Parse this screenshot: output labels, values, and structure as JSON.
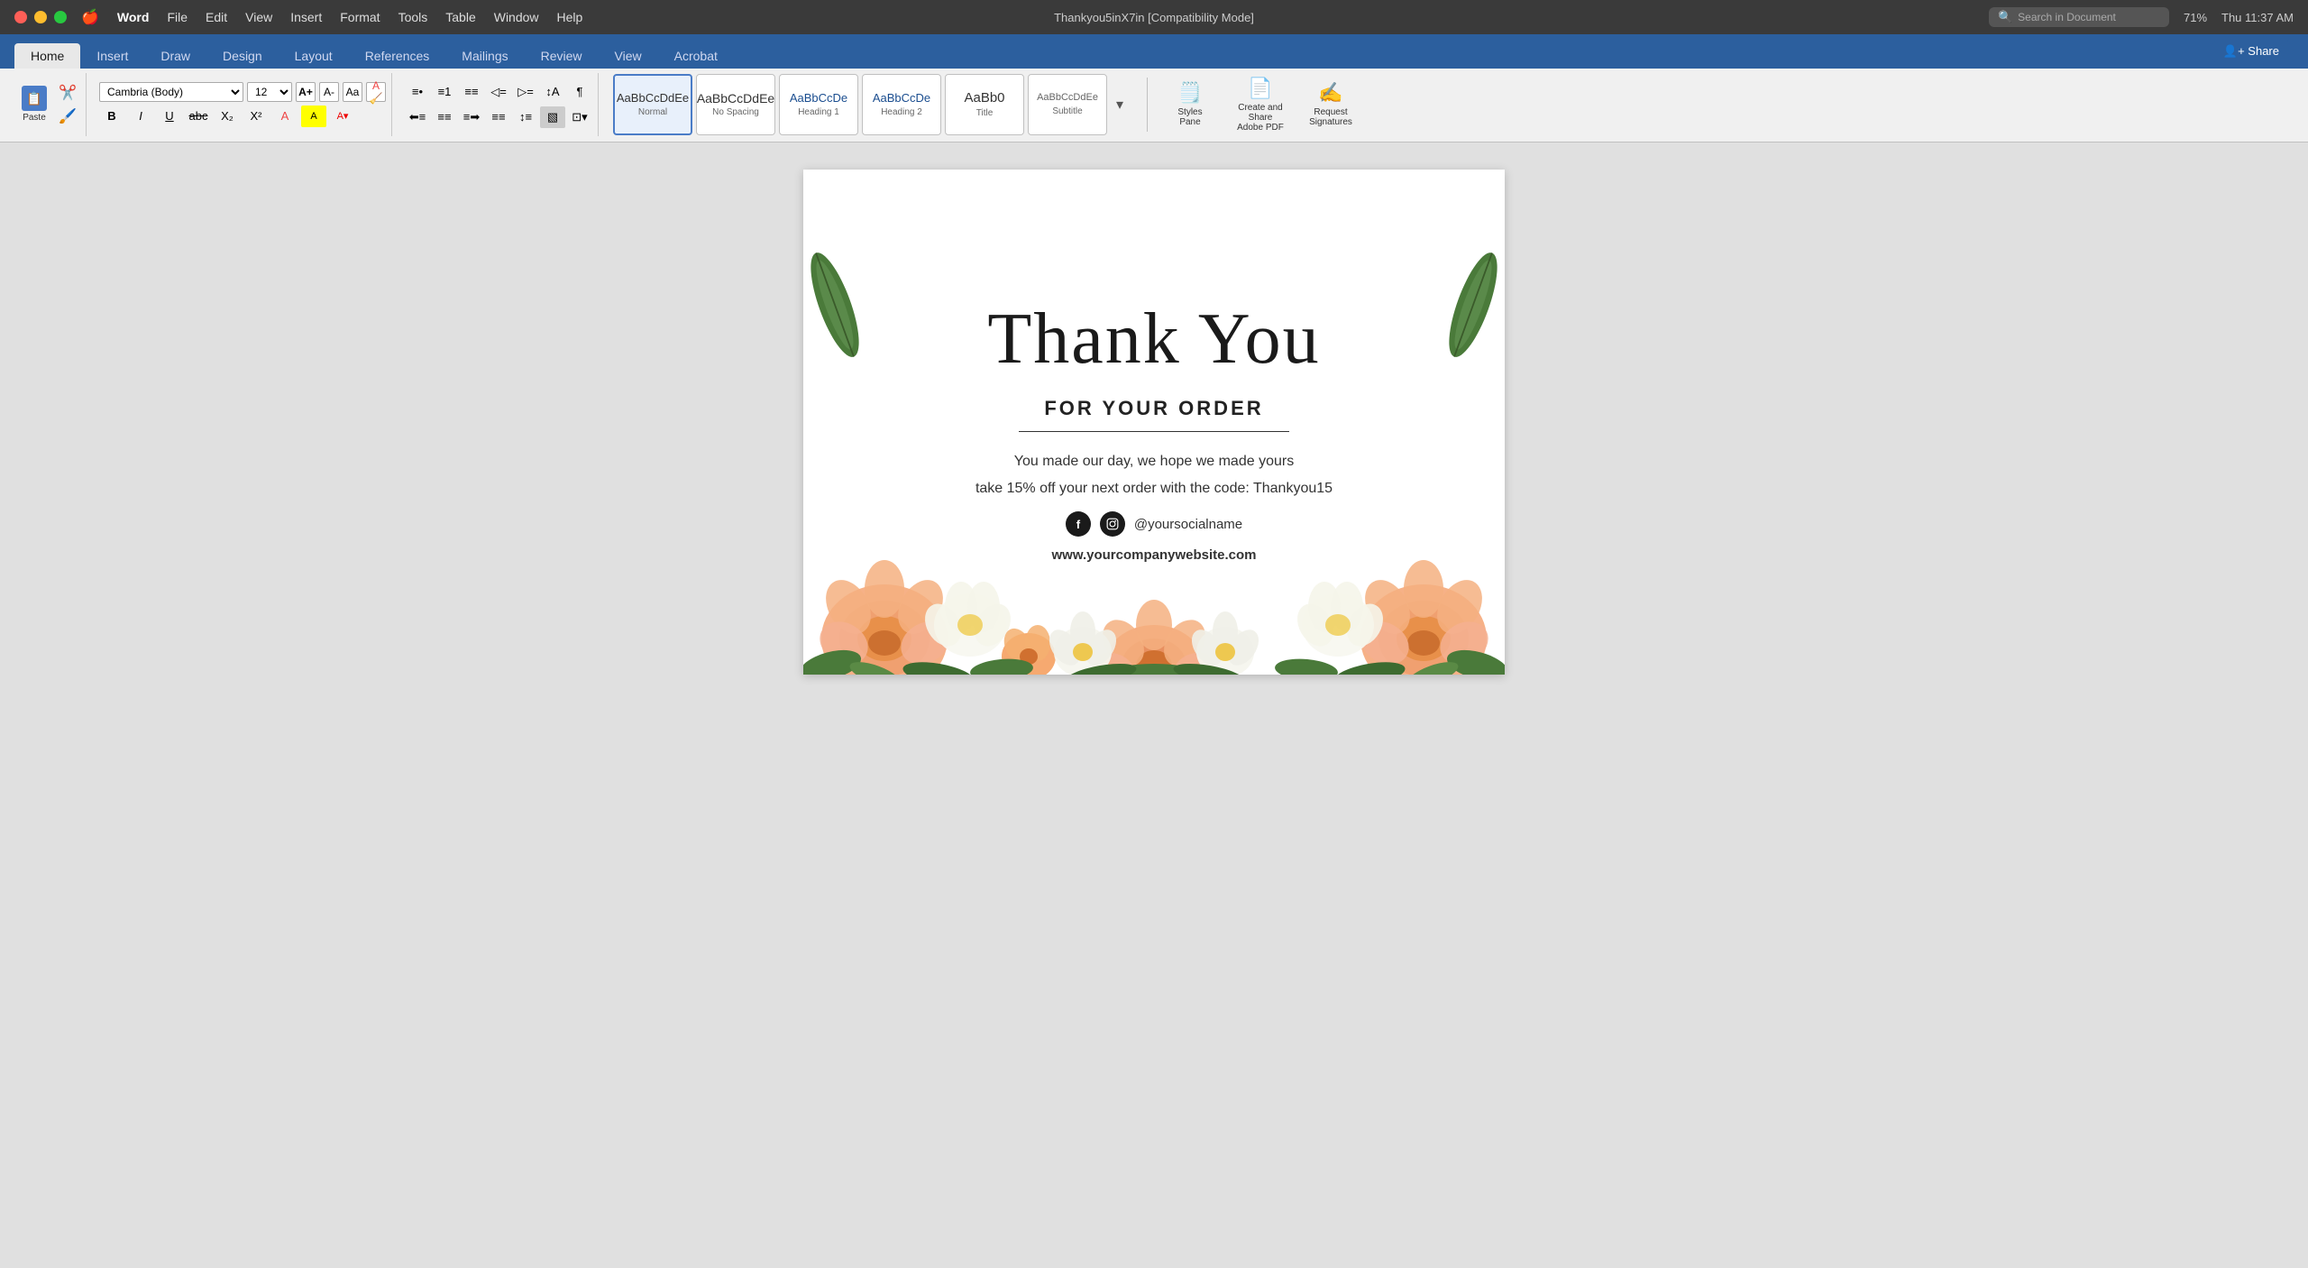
{
  "titleBar": {
    "apple": "🍎",
    "appName": "Word",
    "menus": [
      "Word",
      "File",
      "Edit",
      "View",
      "Insert",
      "Format",
      "Tools",
      "Table",
      "Window",
      "Help"
    ],
    "documentTitle": "Thankyou5inX7in [Compatibility Mode]",
    "time": "Thu 11:37 AM",
    "battery": "71%",
    "searchPlaceholder": "Search in Document",
    "shareLabel": "Share"
  },
  "ribbon": {
    "tabs": [
      "Home",
      "Insert",
      "Draw",
      "Design",
      "Layout",
      "References",
      "Mailings",
      "Review",
      "View",
      "Acrobat"
    ],
    "activeTab": "Home",
    "font": {
      "family": "Cambria (Body)",
      "size": "12",
      "growLabel": "A",
      "shrinkLabel": "A"
    },
    "formatButtons": [
      "B",
      "I",
      "U",
      "abc",
      "X₂",
      "X²"
    ],
    "styles": [
      {
        "id": "normal",
        "preview": "AaBbCcDdEe",
        "name": "Normal",
        "active": true
      },
      {
        "id": "no-spacing",
        "preview": "AaBbCcDdEe",
        "name": "No Spacing",
        "active": false
      },
      {
        "id": "heading-1",
        "preview": "AaBbCcDe",
        "name": "Heading 1",
        "active": false
      },
      {
        "id": "heading-2",
        "preview": "AaBbCcDe",
        "name": "Heading 2",
        "active": false
      },
      {
        "id": "title",
        "preview": "AaBb0",
        "name": "Title",
        "active": false
      },
      {
        "id": "subtitle",
        "preview": "AaBbCcDdEe",
        "name": "Subtitle",
        "active": false
      }
    ],
    "rightActions": {
      "stylesPane": "Styles\nPane",
      "createPDF": "Create and Share\nAdobe PDF",
      "signatures": "Request\nSignatures"
    },
    "pasteLabel": "Paste"
  },
  "document": {
    "thankYou": "Thank You",
    "forYourOrder": "FOR YOUR ORDER",
    "bodyText": "You made our day, we hope we made yours",
    "discountText": "take 15% off your next order with the code: Thankyou15",
    "socialName": "@yoursocialname",
    "website": "www.yourcompanywebsite.com"
  },
  "colors": {
    "ribbonBg": "#2c5f9e",
    "activeTab": "#e8e8e8",
    "documentBg": "#ffffff",
    "pageBg": "#e0e0e0",
    "titleBarBg": "#3a3a3a",
    "accentBlue": "#4a7cc7"
  }
}
